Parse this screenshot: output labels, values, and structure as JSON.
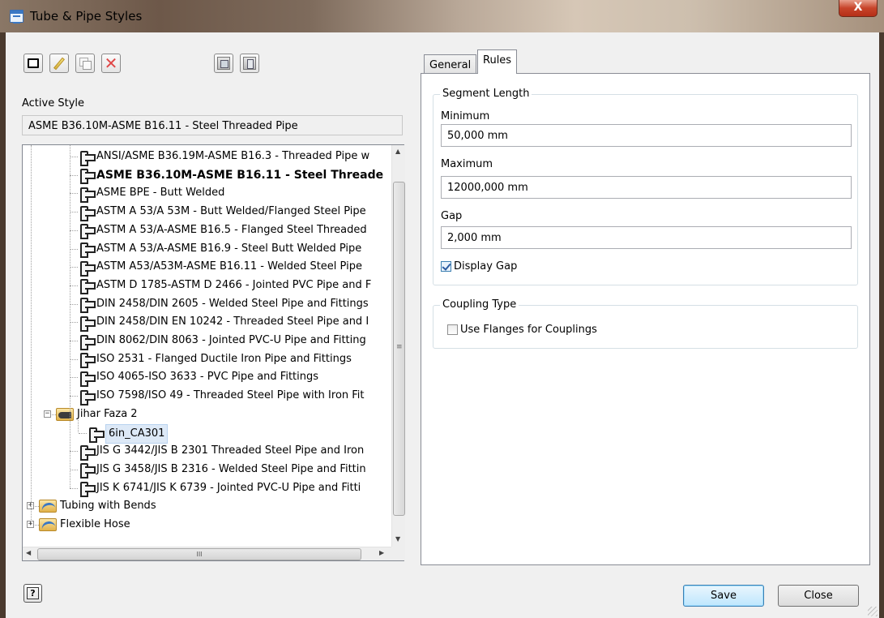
{
  "window": {
    "title": "Tube & Pipe Styles",
    "close_glyph": "X"
  },
  "toolbar": {
    "buttons": [
      {
        "name": "new-style-button",
        "icon": "new-document-icon"
      },
      {
        "name": "edit-style-button",
        "icon": "pencil-icon"
      },
      {
        "name": "copy-style-button",
        "icon": "copy-icon"
      },
      {
        "name": "delete-style-button",
        "icon": "delete-icon"
      },
      {
        "name": "import-style-button",
        "icon": "import-icon"
      },
      {
        "name": "export-style-button",
        "icon": "export-icon"
      }
    ]
  },
  "active_style": {
    "label": "Active Style",
    "value": "ASME B36.10M-ASME B16.11 - Steel Threaded Pipe"
  },
  "tree": {
    "items": [
      {
        "text": "ANSI/ASME B36.19M-ASME B16.3 - Threaded Pipe w",
        "kind": "pipe",
        "level": 2
      },
      {
        "text": "ASME B36.10M-ASME B16.11 - Steel Threade",
        "kind": "pipe",
        "level": 2,
        "bold": true
      },
      {
        "text": "ASME BPE - Butt Welded",
        "kind": "pipe",
        "level": 2
      },
      {
        "text": "ASTM A 53/A 53M - Butt Welded/Flanged Steel Pipe",
        "kind": "pipe",
        "level": 2
      },
      {
        "text": "ASTM A 53/A-ASME B16.5 - Flanged Steel Threaded",
        "kind": "pipe",
        "level": 2
      },
      {
        "text": "ASTM A 53/A-ASME B16.9 - Steel Butt Welded Pipe",
        "kind": "pipe",
        "level": 2
      },
      {
        "text": "ASTM A53/A53M-ASME B16.11 - Welded Steel Pipe",
        "kind": "pipe",
        "level": 2
      },
      {
        "text": "ASTM D 1785-ASTM D 2466 - Jointed PVC Pipe and F",
        "kind": "pipe",
        "level": 2
      },
      {
        "text": "DIN 2458/DIN 2605 - Welded Steel Pipe and Fittings",
        "kind": "pipe",
        "level": 2
      },
      {
        "text": "DIN 2458/DIN EN 10242 - Threaded Steel Pipe and I",
        "kind": "pipe",
        "level": 2
      },
      {
        "text": "DIN 8062/DIN 8063 - Jointed PVC-U Pipe and Fitting",
        "kind": "pipe",
        "level": 2
      },
      {
        "text": "ISO 2531 - Flanged Ductile Iron Pipe and Fittings",
        "kind": "pipe",
        "level": 2
      },
      {
        "text": "ISO 4065-ISO 3633 - PVC Pipe and Fittings",
        "kind": "pipe",
        "level": 2
      },
      {
        "text": "ISO 7598/ISO 49 - Threaded Steel Pipe with Iron Fit",
        "kind": "pipe",
        "level": 2
      },
      {
        "text": "Jihar Faza 2",
        "kind": "folder",
        "level": 1,
        "expanded": true
      },
      {
        "text": "6in_CA301",
        "kind": "pipe",
        "level": 3,
        "selected": true
      },
      {
        "text": "JIS G 3442/JIS B 2301 Threaded Steel Pipe and Iron",
        "kind": "pipe",
        "level": 2
      },
      {
        "text": "JIS G 3458/JIS B 2316 -  Welded Steel Pipe and Fittin",
        "kind": "pipe",
        "level": 2
      },
      {
        "text": "JIS K 6741/JIS K 6739 - Jointed PVC-U Pipe and Fitti",
        "kind": "pipe",
        "level": 2
      },
      {
        "text": "Tubing with Bends",
        "kind": "folder-tube",
        "level": 0,
        "expanded": false
      },
      {
        "text": "Flexible Hose",
        "kind": "folder-hose",
        "level": 0,
        "expanded": false
      }
    ]
  },
  "tabs": [
    {
      "label": "General",
      "active": false
    },
    {
      "label": "Rules",
      "active": true
    }
  ],
  "rules": {
    "segment_length": {
      "legend": "Segment Length",
      "minimum_label": "Minimum",
      "minimum_value": "50,000 mm",
      "maximum_label": "Maximum",
      "maximum_value": "12000,000 mm",
      "gap_label": "Gap",
      "gap_value": "2,000 mm",
      "display_gap_label": "Display Gap",
      "display_gap_checked": true
    },
    "coupling_type": {
      "legend": "Coupling Type",
      "use_flanges_label": "Use Flanges for Couplings",
      "use_flanges_checked": false
    }
  },
  "footer": {
    "help_glyph": "?",
    "save_label": "Save",
    "close_label": "Close"
  },
  "scroll_glyphs": {
    "up": "▲",
    "down": "▼",
    "left": "◀",
    "right": "▶",
    "grip_v": "≡",
    "grip_h": "III"
  }
}
